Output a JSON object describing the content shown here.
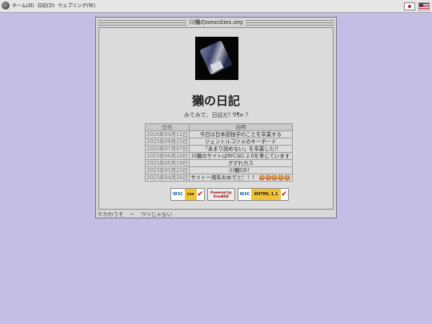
{
  "topbar": {
    "menu": [
      "ホーム(H)",
      "日記(D)",
      "ウェブリング(W)"
    ],
    "languages": [
      "japanese-flag",
      "us-flag"
    ]
  },
  "window": {
    "title": "川獺のneocities.org"
  },
  "page": {
    "heading": "獺の日記",
    "subtitle": "みてみて、日記だ! ∇¶e ?"
  },
  "diary": {
    "columns": [
      "日付",
      "説明"
    ],
    "rows": [
      {
        "date": "2026年04月12日",
        "desc": "今日は日本語独学のことを卒業する"
      },
      {
        "date": "2025年09月25日",
        "desc": "ジェントルコツメのキーボード"
      },
      {
        "date": "2025年07月07日",
        "desc": "「あまり読めない」を卒業した!!"
      },
      {
        "date": "2025年06月20日",
        "desc": "川獺のサイトはWCAG 2.0を準じています"
      },
      {
        "date": "2025年06月19日",
        "desc": "ググれカス"
      },
      {
        "date": "2025年05月25日",
        "desc": "川獺OS！"
      },
      {
        "date": "2025年04月26日",
        "desc": "サイト一周年おめでと！！！ 🍪🍪🍪🍪🍪"
      }
    ]
  },
  "badges": {
    "css": {
      "org": "W3C",
      "label": "css"
    },
    "freebsd": {
      "line1": "Powered by",
      "line2": "FreeBSD"
    },
    "xhtml": {
      "org": "W3C",
      "label": "XHTML 1.1"
    }
  },
  "footer": {
    "author": "©かわうそ",
    "back": "←",
    "note": "ウソじゃない"
  }
}
